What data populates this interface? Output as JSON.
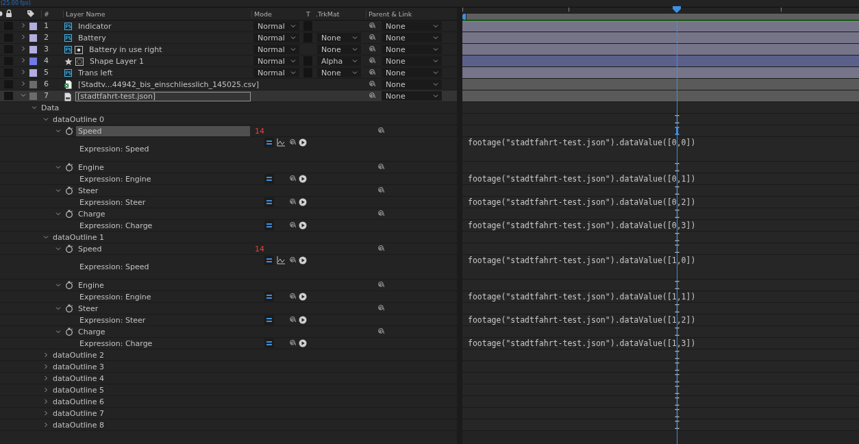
{
  "top_bar": {
    "fps": "(25.00 fps)"
  },
  "columns": {
    "number": "#",
    "layer_name": "Layer Name",
    "mode": "Mode",
    "t": "T",
    "trkmat": ".TrkMat",
    "parent": "Parent & Link"
  },
  "layers": [
    {
      "number": "1",
      "name": "Indicator",
      "icons": [
        {
          "kind": "ps"
        }
      ],
      "color": "#b3aee0",
      "mode": "Normal",
      "t_box": true,
      "parent": "None",
      "expanded": false,
      "selected": false
    },
    {
      "number": "2",
      "name": "Battery",
      "icons": [
        {
          "kind": "ps"
        }
      ],
      "color": "#b3aee0",
      "mode": "Normal",
      "t_box": true,
      "trkmat": "None",
      "parent": "None",
      "expanded": false,
      "selected": false
    },
    {
      "number": "3",
      "name": "Battery in use right",
      "icons": [
        {
          "kind": "ps"
        },
        {
          "kind": "solid"
        }
      ],
      "color": "#b3aee0",
      "mode": "Normal",
      "t_box": false,
      "trkmat": "None",
      "parent": "None",
      "expanded": false,
      "selected": false
    },
    {
      "number": "4",
      "name": "Shape Layer 1",
      "icons": [
        {
          "kind": "star"
        },
        {
          "kind": "shape"
        }
      ],
      "color": "#6f7ae6",
      "mode": "Normal",
      "t_box": true,
      "trkmat": "Alpha",
      "parent": "None",
      "expanded": false,
      "selected": false
    },
    {
      "number": "5",
      "name": "Trans left",
      "icons": [
        {
          "kind": "ps"
        }
      ],
      "color": "#b3aee0",
      "mode": "Normal",
      "t_box": true,
      "trkmat": "None",
      "parent": "None",
      "expanded": false,
      "selected": false
    },
    {
      "number": "6",
      "name": "[Stadtv...44942_bis_einschliesslich_145025.csv]",
      "icons": [
        {
          "kind": "csv"
        }
      ],
      "color": "#6b6b6b",
      "parent": "None",
      "expanded": false,
      "selected": false
    },
    {
      "number": "7",
      "name": "[stadtfahrt-test.json]",
      "icons": [
        {
          "kind": "json"
        }
      ],
      "color": "#6b6b6b",
      "parent": "None",
      "expanded": true,
      "selected": true
    }
  ],
  "data_group": {
    "label": "Data",
    "expanded": true,
    "outlines": [
      {
        "label": "dataOutline 0",
        "expanded": true,
        "properties": [
          {
            "name": "Speed",
            "selected": true,
            "value": "14",
            "graph": true,
            "expression_label": "Expression: Speed",
            "expression": "footage(\"stadtfahrt-test.json\").dataValue([0,0])"
          },
          {
            "name": "Engine",
            "selected": false,
            "graph": false,
            "expression_label": "Expression: Engine",
            "expression": "footage(\"stadtfahrt-test.json\").dataValue([0,1])"
          },
          {
            "name": "Steer",
            "selected": false,
            "graph": false,
            "expression_label": "Expression: Steer",
            "expression": "footage(\"stadtfahrt-test.json\").dataValue([0,2])"
          },
          {
            "name": "Charge",
            "selected": false,
            "graph": false,
            "expression_label": "Expression: Charge",
            "expression": "footage(\"stadtfahrt-test.json\").dataValue([0,3])"
          }
        ]
      },
      {
        "label": "dataOutline 1",
        "expanded": true,
        "properties": [
          {
            "name": "Speed",
            "selected": false,
            "value": "14",
            "graph": true,
            "expression_label": "Expression: Speed",
            "expression": "footage(\"stadtfahrt-test.json\").dataValue([1,0])"
          },
          {
            "name": "Engine",
            "selected": false,
            "graph": false,
            "expression_label": "Expression: Engine",
            "expression": "footage(\"stadtfahrt-test.json\").dataValue([1,1])"
          },
          {
            "name": "Steer",
            "selected": false,
            "graph": false,
            "expression_label": "Expression: Steer",
            "expression": "footage(\"stadtfahrt-test.json\").dataValue([1,2])"
          },
          {
            "name": "Charge",
            "selected": false,
            "graph": false,
            "expression_label": "Expression: Charge",
            "expression": "footage(\"stadtfahrt-test.json\").dataValue([1,3])"
          }
        ]
      },
      {
        "label": "dataOutline 2",
        "expanded": false
      },
      {
        "label": "dataOutline 3",
        "expanded": false
      },
      {
        "label": "dataOutline 4",
        "expanded": false
      },
      {
        "label": "dataOutline 5",
        "expanded": false
      },
      {
        "label": "dataOutline 6",
        "expanded": false
      },
      {
        "label": "dataOutline 7",
        "expanded": false
      },
      {
        "label": "dataOutline 8",
        "expanded": false
      }
    ]
  }
}
